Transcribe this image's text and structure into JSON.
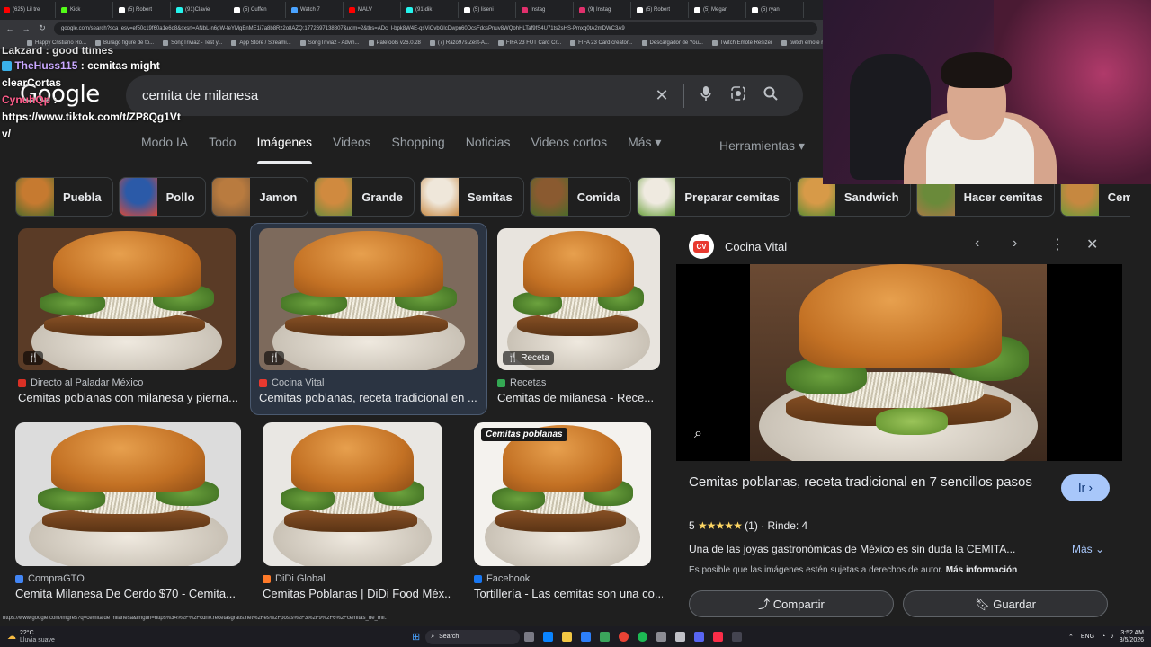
{
  "browser": {
    "tabs": [
      {
        "label": "(625) Lil tre",
        "color": "#ff0000"
      },
      {
        "label": "Kick",
        "color": "#53fc18"
      },
      {
        "label": "(5) Robert",
        "color": "#ffffff"
      },
      {
        "label": "(91)Clavie",
        "color": "#25f4ee"
      },
      {
        "label": "(5) Cuffen",
        "color": "#ffffff"
      },
      {
        "label": "Watch 7",
        "color": "#4aa3ff"
      },
      {
        "label": "MALV",
        "color": "#ff0000"
      },
      {
        "label": "(91)dik",
        "color": "#25f4ee"
      },
      {
        "label": "(5) liseni",
        "color": "#ffffff"
      },
      {
        "label": "Instag",
        "color": "#e1306c"
      },
      {
        "label": "(9) Instag",
        "color": "#e1306c"
      },
      {
        "label": "(5) Robert",
        "color": "#ffffff"
      },
      {
        "label": "(5) Megan",
        "color": "#ffffff"
      },
      {
        "label": "(5) ryan",
        "color": "#ffffff"
      }
    ],
    "url": "google.com/search?sca_esv=ef50c19f60a1e6d8&sxsrf=ANbL-n6gW-feYMgEnME1i7a8b8Rz2o8AZQ:1772697138807&udm=2&tbs=ADc_I-bpk8W4E-qsViOvbGlcDwpn60DcsFdcsPnuv8WQohHLTaf9fS4U71ts2sHS-Pmxg0tA2mDWC3A9",
    "bookmarks": [
      "Happy Cristiano Ro...",
      "Burago figure de to...",
      "SongTrivia2 - Test y...",
      "App Store / Streami...",
      "SongTrivia2 - Advin...",
      "Paletools v26.0.28",
      "(7) Razo97s Zest-A...",
      "FIFA 23 FUT Card Cr...",
      "FIFA 23 Card creator...",
      "Descargador de You...",
      "Twitch Emote Resizer",
      "twitch emote re..."
    ]
  },
  "chat": {
    "line0": "Lakzard : good ttimes",
    "user1": "TheHuss115",
    "msg1": ": cemitas might",
    "msg1b": "clearCortas",
    "user2": "CynuhQp",
    "msg2": ":",
    "msg2b": "https://www.tiktok.com/t/ZP8Qg1Vt",
    "msg2c": "v/"
  },
  "google": {
    "logo": "Google",
    "query": "cemita de milanesa",
    "nav": [
      "Modo IA",
      "Todo",
      "Imágenes",
      "Videos",
      "Shopping",
      "Noticias",
      "Videos cortos",
      "Más ▾"
    ],
    "tools": "Herramientas ▾",
    "chips": [
      "Puebla",
      "Pollo",
      "Jamon",
      "Grande",
      "Semitas",
      "Comida",
      "Preparar cemitas",
      "Sandwich",
      "Hacer cemitas",
      "Cemitas"
    ]
  },
  "results": [
    {
      "source": "Directo al Paladar México",
      "title": "Cemitas poblanas con milanesa y pierna...",
      "src_color": "#d93025",
      "badge": "🍴"
    },
    {
      "source": "Cocina Vital",
      "title": "Cemitas poblanas, receta tradicional en ...",
      "src_color": "#e8392f",
      "badge": "🍴"
    },
    {
      "source": "Recetas",
      "title": "Cemitas de milanesa - Rece...",
      "src_color": "#34a853",
      "badge": "🍴 Receta"
    },
    {
      "source": "CompraGTO",
      "title": "Cemita Milanesa De Cerdo $70 - Cemita...",
      "src_color": "#4285f4"
    },
    {
      "source": "DiDi Global",
      "title": "Cemitas Poblanas | DiDi Food Méx...",
      "src_color": "#ff7a29"
    },
    {
      "source": "Facebook",
      "title": "Tortillería - Las cemitas son una co...",
      "src_color": "#1877f2"
    }
  ],
  "sign_text": "Cemitas poblanas",
  "panel": {
    "site": "Cocina Vital",
    "logo_text": "CV",
    "title": "Cemitas poblanas, receta tradicional en 7 sencillos pasos",
    "go_label": "Ir ›",
    "rating": "5",
    "stars": "★★★★★",
    "rating_count": "(1)",
    "yield": "· Rinde: 4",
    "description": "Una de las joyas gastronómicas de México es sin duda la CEMITA...",
    "more": "Más ⌄",
    "copyright": "Es posible que las imágenes estén sujetas a derechos de autor.",
    "copyright_link": "Más información",
    "share": "Compartir",
    "save": "Guardar"
  },
  "statusbar_url": "https://www.google.com/imgres?q=cemita de milanesa&imgurl=https%3A%2F%2Fcdn0.recetasgratis.net%2Fes%2Fposts%2F3%2F9%2F6%2Fcemitas_de_mil...",
  "taskbar": {
    "weather_temp": "22°C",
    "weather_desc": "Lluvia suave",
    "search": "Search",
    "lang": "ENG",
    "time": "3:52 AM",
    "date": "3/5/2026"
  }
}
